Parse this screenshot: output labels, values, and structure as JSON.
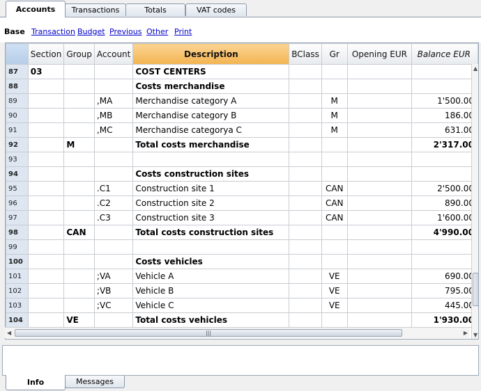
{
  "top_tabs": [
    "Accounts",
    "Transactions",
    "Totals",
    "VAT codes"
  ],
  "views": [
    "Base",
    "Transaction",
    "Budget",
    "Previous",
    "Other",
    "Print"
  ],
  "columns": [
    "",
    "Section",
    "Group",
    "Account",
    "Description",
    "BClass",
    "Gr",
    "Opening EUR",
    "Balance EUR"
  ],
  "rows": [
    {
      "n": "87",
      "section": "03",
      "group": "",
      "account": "",
      "desc": "COST CENTERS",
      "bclass": "",
      "gr": "",
      "opening": "",
      "balance": "",
      "bold": true
    },
    {
      "n": "88",
      "section": "",
      "group": "",
      "account": "",
      "desc": "Costs merchandise",
      "bclass": "",
      "gr": "",
      "opening": "",
      "balance": "",
      "bold": true
    },
    {
      "n": "89",
      "section": "",
      "group": "",
      ",MA": "",
      "account": ",MA",
      "desc": "Merchandise category A",
      "bclass": "",
      "gr": "M",
      "opening": "",
      "balance": "1'500.00",
      "bold": false
    },
    {
      "n": "90",
      "section": "",
      "group": "",
      "account": ",MB",
      "desc": "Merchandise category B",
      "bclass": "",
      "gr": "M",
      "opening": "",
      "balance": "186.00",
      "bold": false
    },
    {
      "n": "91",
      "section": "",
      "group": "",
      "account": ",MC",
      "desc": "Merchandise categorya C",
      "bclass": "",
      "gr": "M",
      "opening": "",
      "balance": "631.00",
      "bold": false
    },
    {
      "n": "92",
      "section": "",
      "group": "M",
      "account": "",
      "desc": "Total costs merchandise",
      "bclass": "",
      "gr": "",
      "opening": "",
      "balance": "2'317.00",
      "bold": true
    },
    {
      "n": "93",
      "section": "",
      "group": "",
      "account": "",
      "desc": "",
      "bclass": "",
      "gr": "",
      "opening": "",
      "balance": "",
      "bold": false
    },
    {
      "n": "94",
      "section": "",
      "group": "",
      "account": "",
      "desc": "Costs construction sites",
      "bclass": "",
      "gr": "",
      "opening": "",
      "balance": "",
      "bold": true
    },
    {
      "n": "95",
      "section": "",
      "group": "",
      "account": ".C1",
      "desc": "Construction site 1",
      "bclass": "",
      "gr": "CAN",
      "opening": "",
      "balance": "2'500.00",
      "bold": false
    },
    {
      "n": "96",
      "section": "",
      "group": "",
      "account": ".C2",
      "desc": "Construction site 2",
      "bclass": "",
      "gr": "CAN",
      "opening": "",
      "balance": "890.00",
      "bold": false
    },
    {
      "n": "97",
      "section": "",
      "group": "",
      "account": ".C3",
      "desc": "Construction site 3",
      "bclass": "",
      "gr": "CAN",
      "opening": "",
      "balance": "1'600.00",
      "bold": false
    },
    {
      "n": "98",
      "section": "",
      "group": "CAN",
      "account": "",
      "desc": "Total costs construction sites",
      "bclass": "",
      "gr": "",
      "opening": "",
      "balance": "4'990.00",
      "bold": true
    },
    {
      "n": "99",
      "section": "",
      "group": "",
      "account": "",
      "desc": "",
      "bclass": "",
      "gr": "",
      "opening": "",
      "balance": "",
      "bold": false
    },
    {
      "n": "100",
      "section": "",
      "group": "",
      "account": "",
      "desc": "Costs vehicles",
      "bclass": "",
      "gr": "",
      "opening": "",
      "balance": "",
      "bold": true
    },
    {
      "n": "101",
      "section": "",
      "group": "",
      "account": ";VA",
      "desc": "Vehicle A",
      "bclass": "",
      "gr": "VE",
      "opening": "",
      "balance": "690.00",
      "bold": false
    },
    {
      "n": "102",
      "section": "",
      "group": "",
      "account": ";VB",
      "desc": "Vehicle B",
      "bclass": "",
      "gr": "VE",
      "opening": "",
      "balance": "795.00",
      "bold": false
    },
    {
      "n": "103",
      "section": "",
      "group": "",
      "account": ";VC",
      "desc": "Vehicle C",
      "bclass": "",
      "gr": "VE",
      "opening": "",
      "balance": "445.00",
      "bold": false
    },
    {
      "n": "104",
      "section": "",
      "group": "VE",
      "account": "",
      "desc": "Total costs vehicles",
      "bclass": "",
      "gr": "",
      "opening": "",
      "balance": "1'930.00",
      "bold": true
    }
  ],
  "bottom_tabs": [
    "Info",
    "Messages"
  ],
  "scroll_grip": "|||"
}
